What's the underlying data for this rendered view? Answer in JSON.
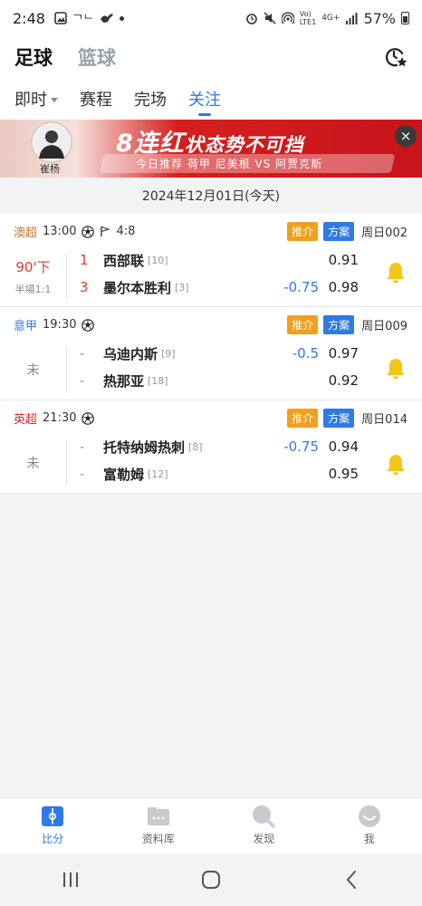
{
  "status_bar": {
    "time": "2:48",
    "carrier_text": "ᄀᄂ",
    "net_labels": [
      "Vo)",
      "LTE1",
      "4G+"
    ],
    "battery": "57%"
  },
  "header": {
    "sport_tabs": [
      {
        "label": "足球",
        "active": true
      },
      {
        "label": "篮球",
        "active": false
      }
    ]
  },
  "subtabs": [
    {
      "label": "即时",
      "active": false,
      "dropdown": true
    },
    {
      "label": "赛程",
      "active": false
    },
    {
      "label": "完场",
      "active": false
    },
    {
      "label": "关注",
      "active": true
    }
  ],
  "banner": {
    "avatar_name": "崔杨",
    "headline_num": "8",
    "headline_a": "连红",
    "headline_b": "状态势不可挡",
    "sub": "今日推荐   荷甲   尼美根 VS 阿贾克斯",
    "close": "×"
  },
  "date": "2024年12月01日(今天)",
  "matches": [
    {
      "league": "澳超",
      "league_color": "#c0762a",
      "time": "13:00",
      "corners": "4:8",
      "tag1": "推介",
      "tag2": "方案",
      "weekno": "周日002",
      "status": "90'下",
      "status_live": true,
      "halftime": "半場1:1",
      "home": {
        "score": "1",
        "name": "西部联",
        "rank": "[10]",
        "handicap": "",
        "odds": "0.91"
      },
      "away": {
        "score": "3",
        "name": "墨尔本胜利",
        "rank": "[3]",
        "handicap": "-0.75",
        "odds": "0.98"
      }
    },
    {
      "league": "意甲",
      "league_color": "#2f7ae5",
      "time": "19:30",
      "corners": "",
      "tag1": "推介",
      "tag2": "方案",
      "weekno": "周日009",
      "status": "未",
      "status_live": false,
      "halftime": "",
      "home": {
        "score": "-",
        "name": "乌迪内斯",
        "rank": "[9]",
        "handicap": "-0.5",
        "odds": "0.97"
      },
      "away": {
        "score": "-",
        "name": "热那亚",
        "rank": "[18]",
        "handicap": "",
        "odds": "0.92"
      }
    },
    {
      "league": "英超",
      "league_color": "#d8262c",
      "time": "21:30",
      "corners": "",
      "tag1": "推介",
      "tag2": "方案",
      "weekno": "周日014",
      "status": "未",
      "status_live": false,
      "halftime": "",
      "home": {
        "score": "-",
        "name": "托特纳姆热刺",
        "rank": "[8]",
        "handicap": "-0.75",
        "odds": "0.94"
      },
      "away": {
        "score": "-",
        "name": "富勒姆",
        "rank": "[12]",
        "handicap": "",
        "odds": "0.95"
      }
    }
  ],
  "bottom_nav": [
    {
      "label": "比分",
      "icon": "score-icon",
      "active": true
    },
    {
      "label": "资料库",
      "icon": "database-icon",
      "active": false
    },
    {
      "label": "发现",
      "icon": "discover-icon",
      "active": false
    },
    {
      "label": "我",
      "icon": "profile-icon",
      "active": false
    }
  ],
  "colors": {
    "accent": "#2f7ae5",
    "live": "#e53b2f",
    "tag_recommend": "#f2a01c",
    "bell": "#f5c518"
  }
}
